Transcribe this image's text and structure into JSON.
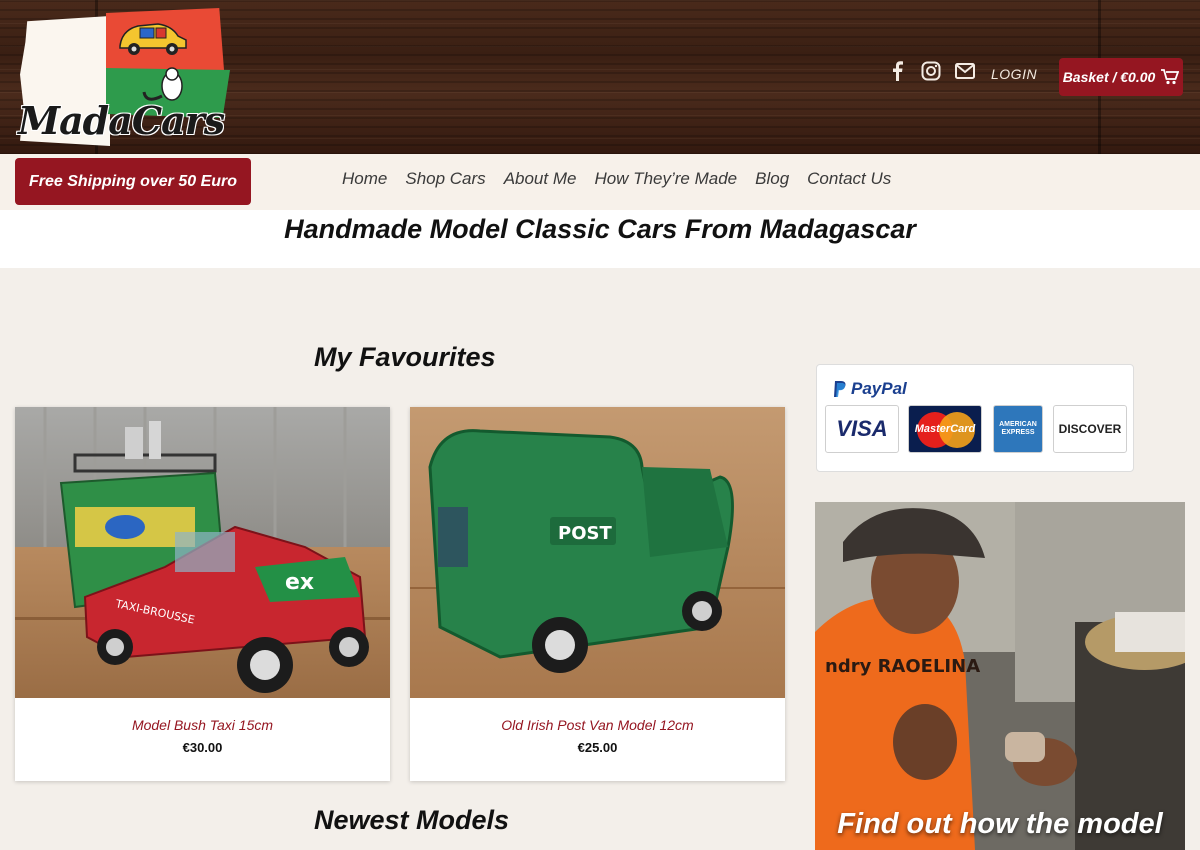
{
  "header": {
    "logo_text": "MadaCars",
    "login_label": "LOGIN",
    "basket_label": "Basket / €0.00",
    "icons": [
      "facebook-icon",
      "instagram-icon",
      "envelope-icon",
      "cart-icon"
    ]
  },
  "nav": {
    "shipping_label": "Free Shipping over 50 Euro",
    "links": [
      "Home",
      "Shop Cars",
      "About Me",
      "How They’re Made",
      "Blog",
      "Contact Us"
    ]
  },
  "tagline": "Handmade Model Classic Cars From Madagascar",
  "favourites": {
    "title": "My Favourites",
    "products": [
      {
        "name": "Model Bush Taxi 15cm",
        "price": "€30.00"
      },
      {
        "name": "Old Irish Post Van Model 12cm",
        "price": "€25.00"
      }
    ]
  },
  "newest": {
    "title": "Newest Models"
  },
  "sidebar": {
    "paypal_label": "PayPal",
    "cards": [
      "VISA",
      "MasterCard",
      "AMERICAN EXPRESS",
      "DISCOVER"
    ],
    "promo_text": "Find out how the model"
  },
  "colors": {
    "brand_red": "#951621",
    "wood": "#3a1f13",
    "nav_bg": "#f7f1ea"
  }
}
